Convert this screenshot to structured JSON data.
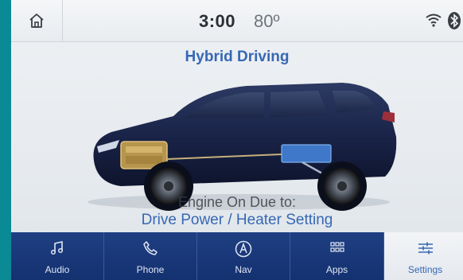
{
  "status": {
    "time": "3:00",
    "temperature": "80º"
  },
  "screen": {
    "title": "Hybrid Driving",
    "engine_message": "Engine On Due to:",
    "engine_reason": "Drive Power / Heater Setting"
  },
  "nav": [
    {
      "label": "Audio",
      "icon": "music-note-icon"
    },
    {
      "label": "Phone",
      "icon": "phone-icon"
    },
    {
      "label": "Nav",
      "icon": "navigation-icon"
    },
    {
      "label": "Apps",
      "icon": "apps-grid-icon"
    },
    {
      "label": "Settings",
      "icon": "sliders-icon",
      "active": true
    }
  ],
  "colors": {
    "accent": "#3668b4",
    "nav_bg": "#1f3f82",
    "bezel": "#0a8a95"
  }
}
